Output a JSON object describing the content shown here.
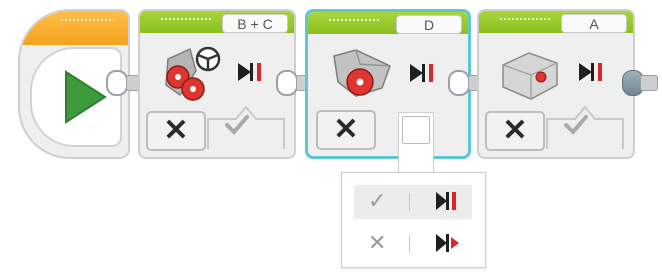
{
  "colors": {
    "start_cap": "#f4a21a",
    "motor_cap": "#8ac020",
    "selection_outline": "#5cc7d6",
    "play_triangle": "#3d9a3d",
    "brake_red": "#d9262e"
  },
  "start_block": {
    "icon": "play-icon"
  },
  "blocks": [
    {
      "port": "B + C",
      "motor_icon": "steering-motor-icon",
      "mode_symbol": "✕",
      "brake_icon": "brake-stop-icon",
      "check_symbol": "✓"
    },
    {
      "port": "D",
      "motor_icon": "large-motor-icon",
      "mode_symbol": "✕",
      "brake_icon": "brake-stop-icon",
      "check_symbol": "✓"
    },
    {
      "port": "A",
      "motor_icon": "medium-motor-icon",
      "mode_symbol": "✕",
      "brake_icon": "brake-stop-icon",
      "check_symbol": "✓"
    }
  ],
  "dropdown": {
    "options": [
      {
        "symbol": "✓",
        "icon": "brake-stop-icon",
        "selected": true
      },
      {
        "symbol": "✕",
        "icon": "coast-icon",
        "selected": false
      }
    ]
  }
}
